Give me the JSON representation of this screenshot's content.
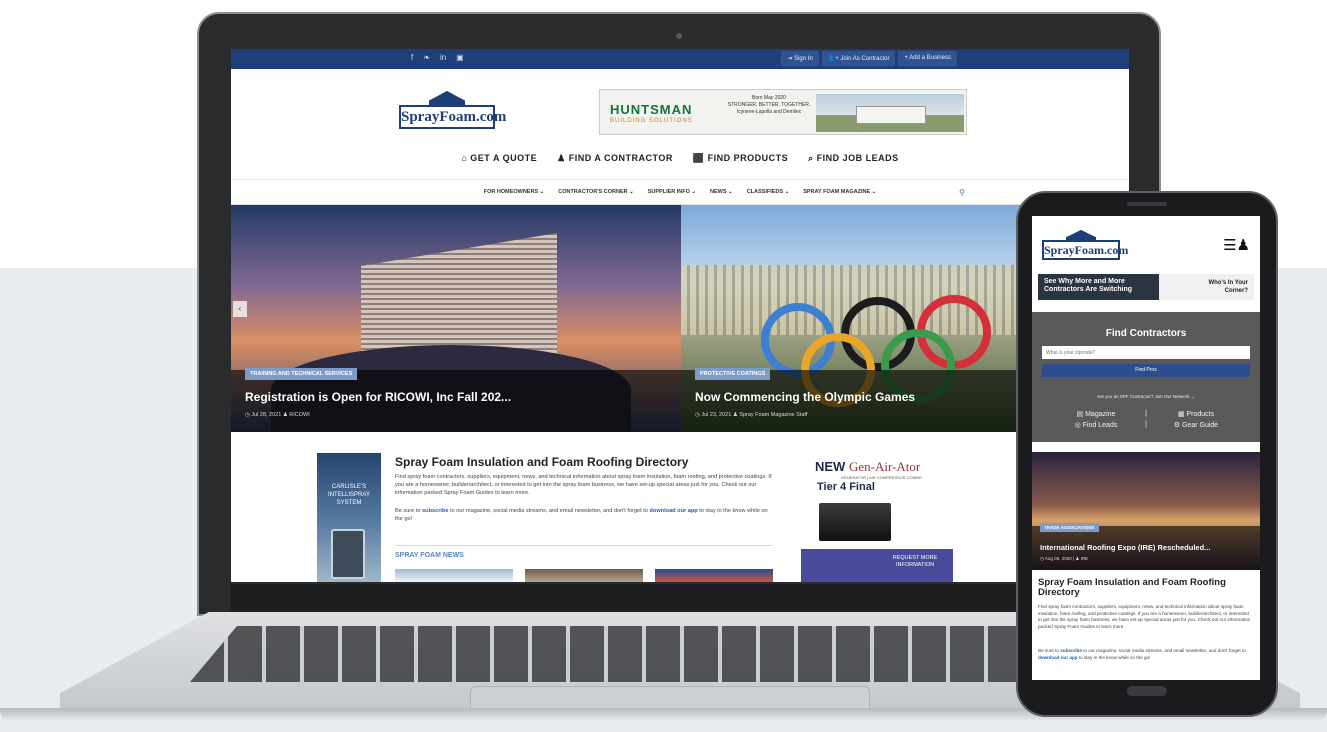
{
  "laptop": {
    "social_icons": [
      "f",
      "❧",
      "in",
      "▣"
    ],
    "top_buttons": [
      "⇥ Sign In",
      "👤+ Join As Contractor",
      "+ Add a Business"
    ],
    "logo": "SprayFoam.com",
    "banner": {
      "brand": "HUNTSMAN",
      "sub": "BUILDING SOLUTIONS",
      "line1": "Born May 2020",
      "line2": "STRONGER. BETTER. TOGETHER.",
      "line3": "Icynene-Lapolla and Demilec"
    },
    "main_nav": [
      "⌂ GET A QUOTE",
      "♟ FIND A CONTRACTOR",
      "⬛ FIND PRODUCTS",
      "⌕ FIND JOB LEADS"
    ],
    "sub_nav": [
      "FOR HOMEOWNERS ⌄",
      "CONTRACTOR'S CORNER ⌄",
      "SUPPLIER INFO ⌄",
      "NEWS ⌄",
      "CLASSIFIEDS ⌄",
      "SPRAY FOAM MAGAZINE ⌄"
    ],
    "slides": [
      {
        "tag": "TRAINING AND TECHNICAL SERVICES",
        "title": "Registration is Open for RICOWI, Inc Fall 202...",
        "meta": "◷ Jul 28, 2021   ♟ RICOWI"
      },
      {
        "tag": "PROTECTIVE COATINGS",
        "title": "Now Commencing the Olympic Games",
        "meta": "◷ Jul 23, 2021   ♟ Spray Foam Magazine Staff"
      }
    ],
    "promo_text": "CARLISLE'S INTELLISPRAY SYSTEM",
    "directory": {
      "title": "Spray Foam Insulation and Foam Roofing Directory",
      "p1": "Find spray foam contractors, suppliers, equipment, news, and technical information about spray foam insulation, foam roofing, and protective coatings. If you are a homeowner, builder/architect, or interested to get into the spray foam business, we have set-up special areas just for you. Check out our information packed Spray Foam Guides to learn more.",
      "p2_a": "Be sure to ",
      "p2_link1": "subscribe",
      "p2_b": " to our magazine, social media streams, and email newsletter, and don't forget to ",
      "p2_link2": "download our app",
      "p2_c": " to stay in the know while on the go!",
      "news_head": "SPRAY FOAM NEWS"
    },
    "ad2": {
      "new": "NEW",
      "gen": "Gen-Air-Ator",
      "sub": "GENERATOR | AIR COMPRESSOR COMBO",
      "tier": "Tier 4 Final",
      "btn": "REQUEST MORE INFORMATION"
    }
  },
  "phone": {
    "logo": "SprayFoam.com",
    "menu": "☰♟",
    "ad_left": "See Why More and More Contractors Are Switching",
    "ad_right": "Who's In Your Corner?",
    "find_title": "Find Contractors",
    "zip_placeholder": "What is your zipcode?",
    "find_btn": "Find Pros",
    "spf_line": "Are you an SPF Contractor? Join Our Network →",
    "links": [
      "▤ Magazine",
      "|",
      "▦ Products",
      "◎ Find Leads",
      "|",
      "⚙ Gear Guide"
    ],
    "slide": {
      "tag": "TRADE ASSOCIATIONS",
      "title": "International Roofing Expo (IRE) Rescheduled...",
      "meta": "◷ Aug 06, 2020 | ♟ IRE"
    },
    "dir_title": "Spray Foam Insulation and Foam Roofing Directory",
    "dir_p1": "Find spray foam contractors, suppliers, equipment, news, and technical information about spray foam insulation, foam roofing, and protective coatings. If you are a homeowner, builder/architect, or interested to get into the spray foam business, we have set-up special areas just for you. Check out our information packed Spray Foam Guides to learn more.",
    "dir_p2_a": "Be sure to ",
    "dir_p2_link1": "subscribe",
    "dir_p2_b": " to our magazine, social media streams, and email newsletter, and don't forget to ",
    "dir_p2_link2": "download our app",
    "dir_p2_c": " to stay in the know while on the go!"
  },
  "colors": {
    "brand_blue": "#1f3f7a",
    "link_blue": "#1f5fb3",
    "tag_blue": "#7c9bc7"
  }
}
